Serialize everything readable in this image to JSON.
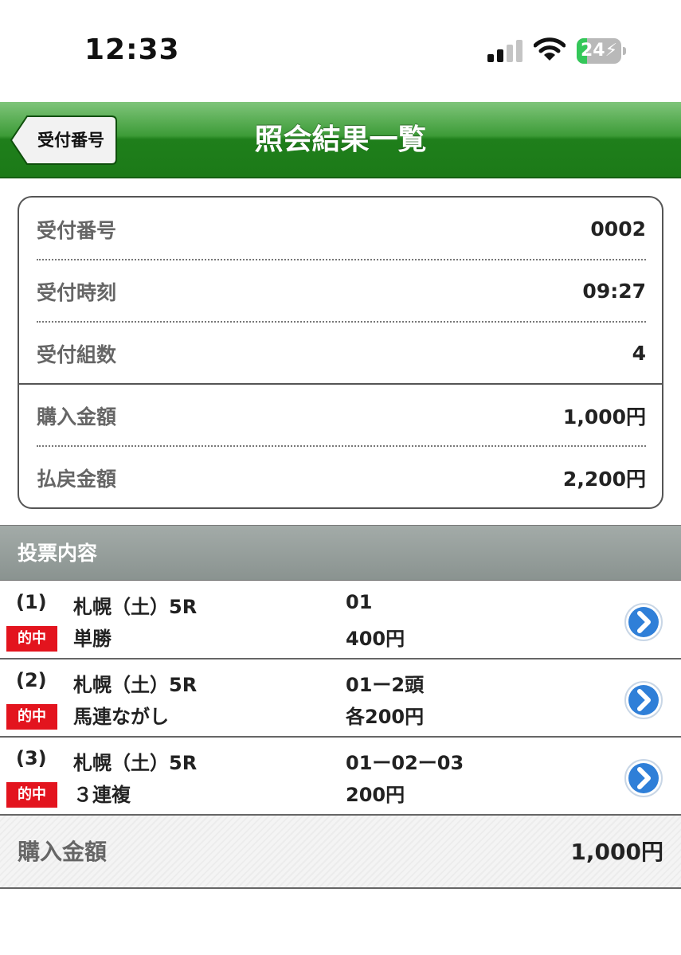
{
  "status_bar": {
    "time": "12:33",
    "battery_level": "24",
    "battery_color": "#34c759",
    "icons": [
      "cellular-signal-icon",
      "wifi-icon",
      "battery-charging-icon"
    ]
  },
  "nav": {
    "back_label": "受付番号",
    "title": "照会結果一覧",
    "bar_color": "#2a8a25"
  },
  "summary": {
    "rows": [
      {
        "label": "受付番号",
        "value": "0002"
      },
      {
        "label": "受付時刻",
        "value": "09:27"
      },
      {
        "label": "受付組数",
        "value": "4"
      },
      {
        "label": "購入金額",
        "value": "1,000円"
      },
      {
        "label": "払戻金額",
        "value": "2,200円"
      }
    ]
  },
  "section": {
    "title": "投票内容"
  },
  "votes": [
    {
      "num": "(1)",
      "race": "札幌（土）5R",
      "badge": "的中",
      "type": "単勝",
      "combo": "01",
      "amount": "400円"
    },
    {
      "num": "(2)",
      "race": "札幌（土）5R",
      "badge": "的中",
      "type": "馬連ながし",
      "combo": "01ー2頭",
      "amount": "各200円"
    },
    {
      "num": "(3)",
      "race": "札幌（土）5R",
      "badge": "的中",
      "type": "３連複",
      "combo": "01ー02ー03",
      "amount": "200円"
    }
  ],
  "footer": {
    "label": "購入金額",
    "value": "1,000円"
  },
  "colors": {
    "hit_badge": "#e3141e",
    "detail_icon": "#2f7fd8"
  }
}
